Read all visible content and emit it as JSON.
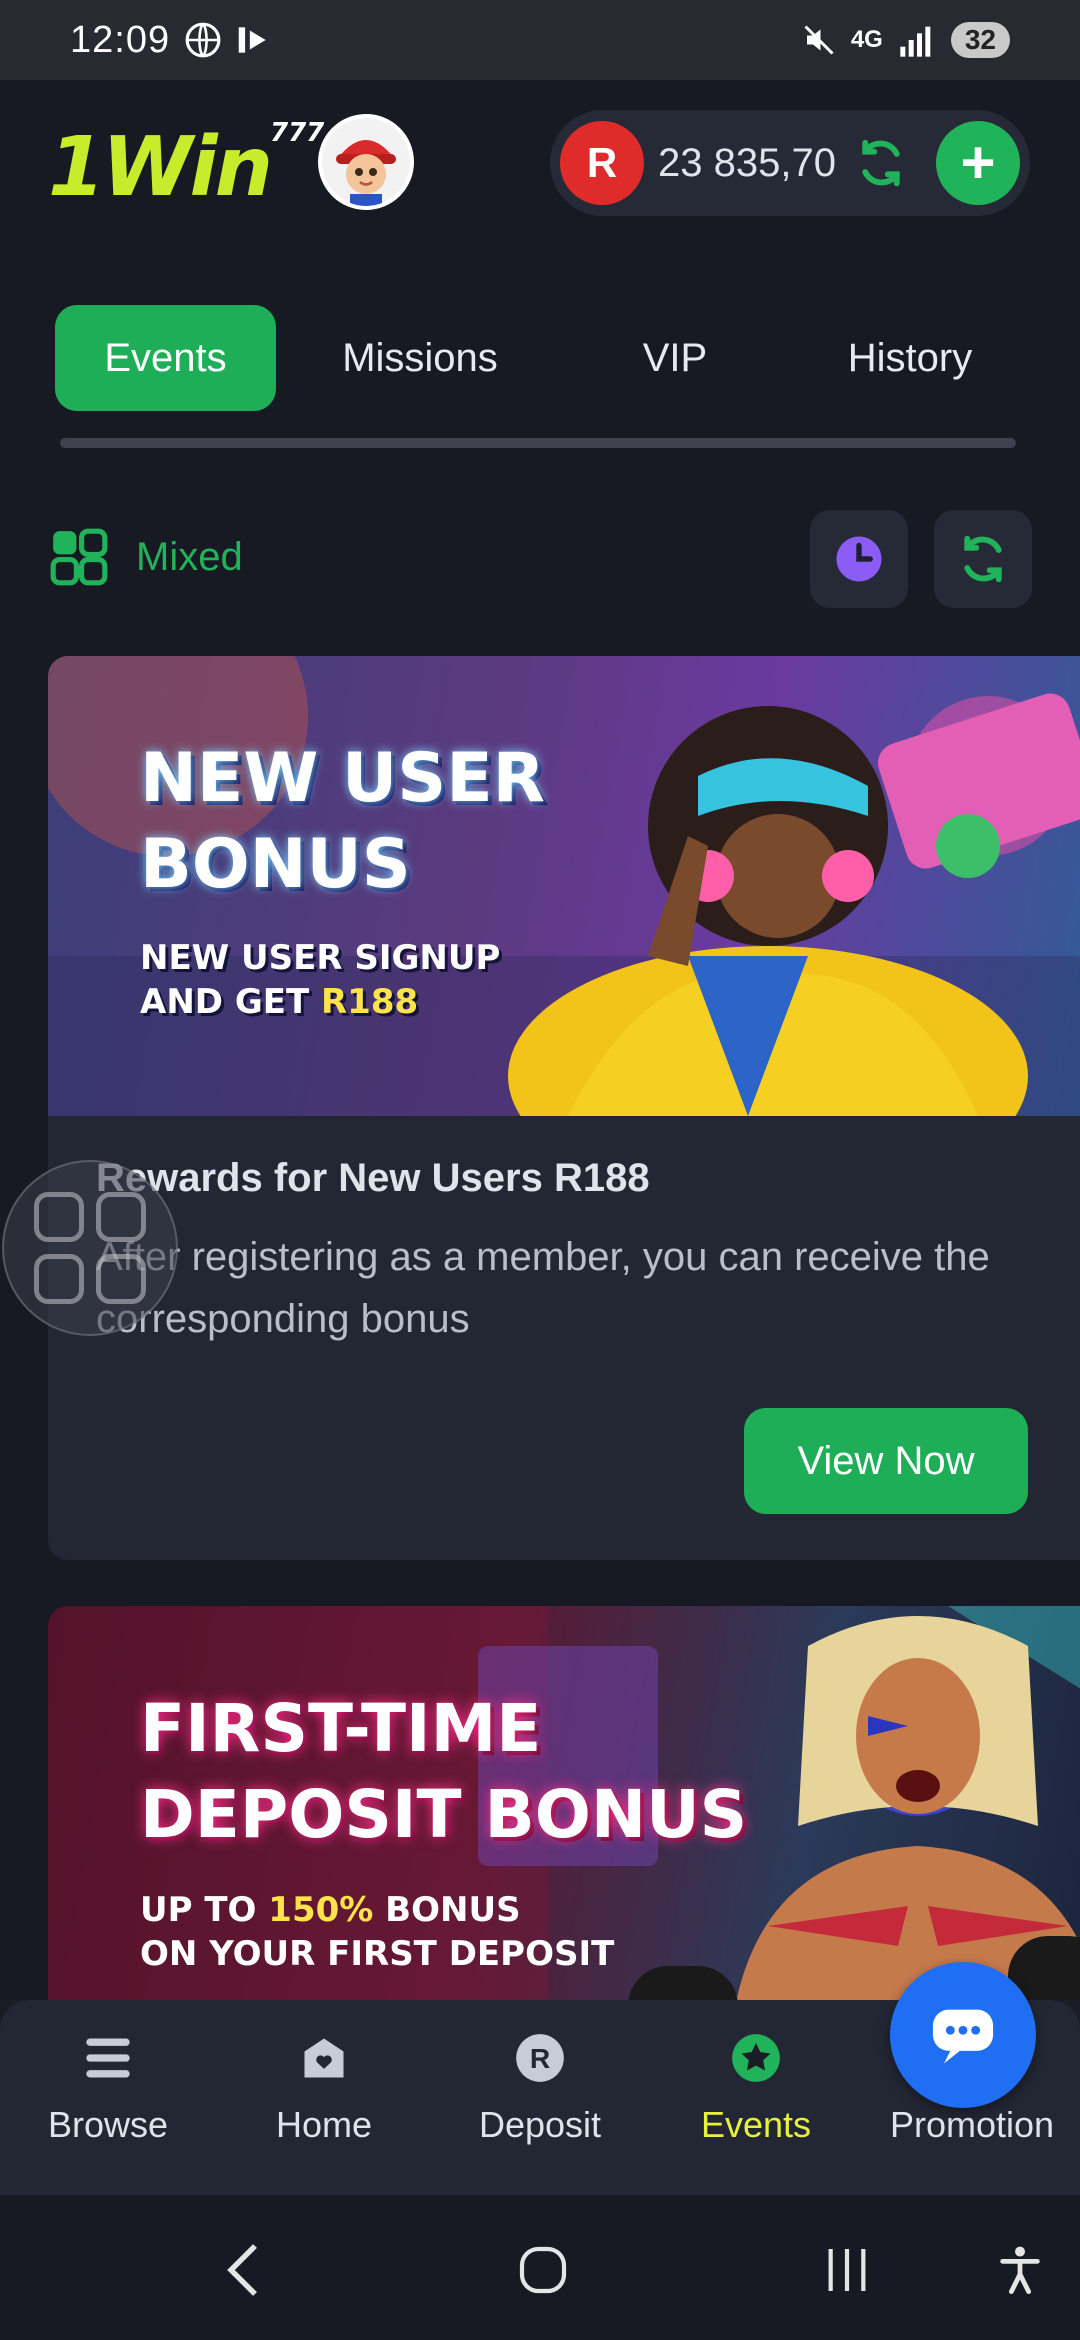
{
  "status": {
    "time": "12:09",
    "network": "4G",
    "battery": "32"
  },
  "header": {
    "logo": "1Win",
    "logo_suffix": "777",
    "currency_symbol": "R",
    "balance": "23 835,70"
  },
  "tabs": [
    {
      "label": "Events",
      "active": true
    },
    {
      "label": "Missions",
      "active": false
    },
    {
      "label": "VIP",
      "active": false
    },
    {
      "label": "History",
      "active": false
    }
  ],
  "filter": {
    "label": "Mixed"
  },
  "cards": [
    {
      "banner_title_1": "NEW USER",
      "banner_title_2": "BONUS",
      "banner_sub_1": "NEW USER SIGNUP",
      "banner_sub_2a": "AND GET ",
      "banner_sub_2b": "R188",
      "title": "Rewards for New Users R188",
      "description": "After registering as a member, you can receive the corresponding bonus",
      "button": "View Now"
    },
    {
      "banner_title_1": "FIRST-TIME",
      "banner_title_2": "DEPOSIT BONUS",
      "banner_sub_1a": "UP TO ",
      "banner_sub_1b": "150%",
      "banner_sub_1c": " BONUS",
      "banner_sub_2": "ON YOUR FIRST DEPOSIT"
    }
  ],
  "bottom_nav": [
    {
      "label": "Browse",
      "icon": "menu-icon"
    },
    {
      "label": "Home",
      "icon": "home-icon"
    },
    {
      "label": "Deposit",
      "icon": "deposit-icon"
    },
    {
      "label": "Events",
      "icon": "events-icon",
      "active": true
    },
    {
      "label": "Promotion",
      "icon": "chat-icon"
    }
  ],
  "colors": {
    "accent": "#1eae58",
    "active_nav": "#e7f03a",
    "fab": "#1f6ef4",
    "coin": "#e02b2b"
  }
}
